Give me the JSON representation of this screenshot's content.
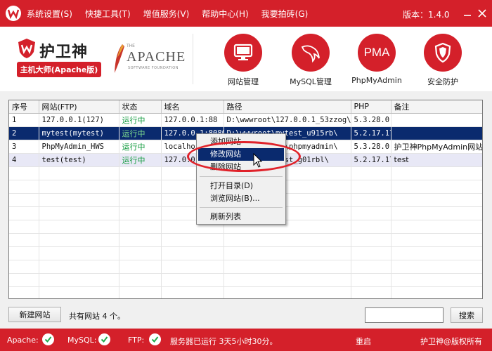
{
  "menu": {
    "items": [
      "系统设置(S)",
      "快捷工具(T)",
      "增值服务(V)",
      "帮助中心(H)",
      "我要拍砖(G)"
    ],
    "version": "版本：1.4.0"
  },
  "brand": {
    "name": "护卫神",
    "subtitle": "主机大师(Apache版)",
    "apache_word": "APACHE",
    "apache_sub": "SOFTWARE FOUNDATION",
    "apache_prefix": "THE"
  },
  "tools": [
    {
      "label": "网站管理",
      "icon": "monitor-icon"
    },
    {
      "label": "MySQL管理",
      "icon": "mysql-dolphin-icon"
    },
    {
      "label": "PhpMyAdmin",
      "icon": "pma-icon",
      "icon_text": "PMA"
    },
    {
      "label": "安全防护",
      "icon": "shield-icon"
    }
  ],
  "table": {
    "headers": [
      "序号",
      "网站(FTP)",
      "状态",
      "域名",
      "路径",
      "PHP",
      "备注"
    ],
    "rows": [
      [
        "1",
        "127.0.0.1(127)",
        "运行中",
        "127.0.0.1:88",
        "D:\\wwwroot\\127.0.0.1_53zzog\\",
        "5.3.28.0",
        ""
      ],
      [
        "2",
        "mytest(mytest)",
        "运行中",
        "127.0.0.1:8080",
        "D:\\wwwroot\\mytest_u915rb\\",
        "5.2.17.17",
        ""
      ],
      [
        "3",
        "PhpMyAdmin_HWS",
        "运行中",
        "localhost:999",
        "D:\\Hws.Master\\phpmyadmin\\",
        "5.3.28.0",
        "护卫神PhpMyAdmin网站"
      ],
      [
        "4",
        "test(test)",
        "运行中",
        "127.0.0.1:80",
        "D:\\wwwroot\\test_g01rbl\\",
        "5.2.17.17",
        "test"
      ]
    ],
    "selected_row": 1
  },
  "context_menu": {
    "items": [
      "添加网站",
      "修改网站",
      "删除网站",
      "打开目录(D)",
      "浏览网站(B)...",
      "刷新列表"
    ],
    "highlighted": 1
  },
  "bottom": {
    "new_site": "新建网站",
    "count_text": "共有网站 4 个。",
    "search_value": "",
    "search_button": "搜索"
  },
  "status": {
    "apache_label": "Apache:",
    "mysql_label": "MySQL:",
    "ftp_label": "FTP:",
    "uptime": "服务器已运行 3天5小时30分。",
    "restart": "重启",
    "copyright": "护卫神@版权所有"
  },
  "colors": {
    "brand_red": "#d4202a",
    "selection_navy": "#0a2a6e",
    "status_green": "#109a3d"
  }
}
